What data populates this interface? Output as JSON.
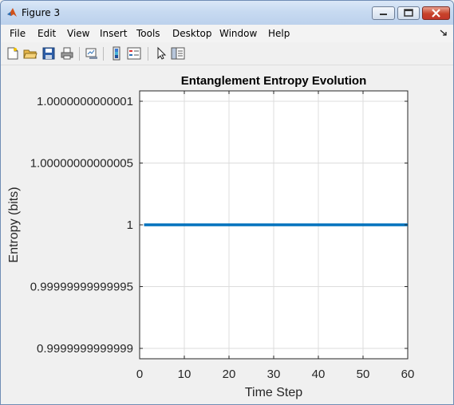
{
  "window": {
    "title": "Figure 3"
  },
  "menu": [
    "File",
    "Edit",
    "View",
    "Insert",
    "Tools",
    "Desktop",
    "Window",
    "Help"
  ],
  "toolbar_icons": [
    "new-figure-icon",
    "open-file-icon",
    "save-icon",
    "print-icon",
    "link-plot-icon",
    "insert-colorbar-icon",
    "insert-legend-icon",
    "pointer-icon",
    "property-inspector-icon"
  ],
  "colors": {
    "line": "#0072bd",
    "axes_bg": "#ffffff",
    "figure_bg": "#f0f0f0",
    "grid": "#dcdcdc"
  },
  "chart_data": {
    "type": "line",
    "title": "Entanglement Entropy Evolution",
    "xlabel": "Time Step",
    "ylabel": "Entropy (bits)",
    "xlim": [
      0,
      60
    ],
    "ylim": [
      0.99999999999999,
      1.00000000000001
    ],
    "xticks": [
      "0",
      "10",
      "20",
      "30",
      "40",
      "50",
      "60"
    ],
    "yticks": [
      "1.0000000000001",
      "1.00000000000005",
      "1",
      "0.99999999999995",
      "0.9999999999999"
    ],
    "grid": true,
    "series": [
      {
        "x": [
          1,
          60
        ],
        "y": [
          1,
          1
        ]
      }
    ]
  }
}
